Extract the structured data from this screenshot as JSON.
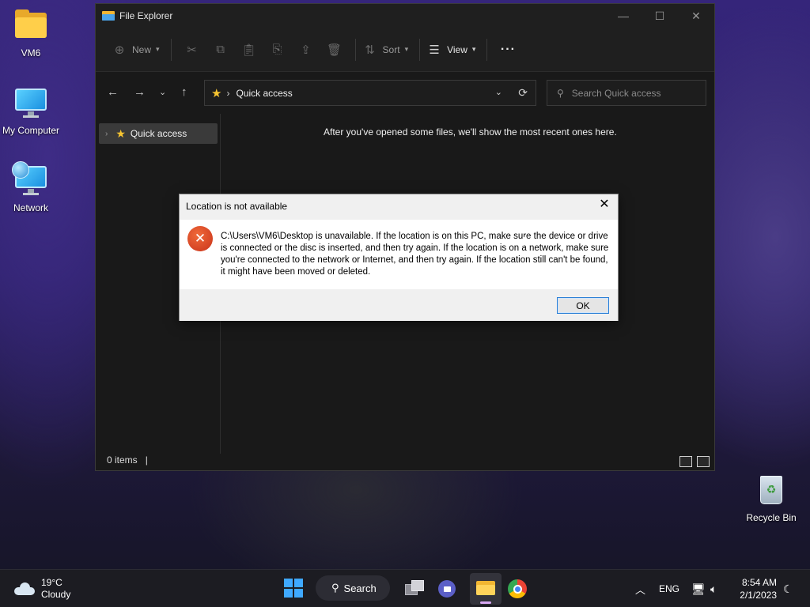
{
  "desktop": {
    "icons": [
      {
        "label": "VM6"
      },
      {
        "label": "My Computer"
      },
      {
        "label": "Network"
      },
      {
        "label": "Recycle Bin"
      }
    ]
  },
  "explorer": {
    "title": "File Explorer",
    "toolbar": {
      "new_label": "New",
      "sort_label": "Sort",
      "view_label": "View"
    },
    "address": {
      "path": "Quick access"
    },
    "search": {
      "placeholder": "Search Quick access"
    },
    "nav_pane": {
      "items": [
        {
          "label": "Quick access"
        }
      ]
    },
    "empty_message": "After you've opened some files, we'll show the most recent ones here.",
    "status": {
      "items_count": "0 items"
    }
  },
  "dialog": {
    "title": "Location is not available",
    "message": "C:\\Users\\VM6\\Desktop is unavailable. If the location is on this PC, make sure the device or drive is connected or the disc is inserted, and then try again. If the location is on a network, make sure you're connected to the network or Internet, and then try again. If the location still can't be found, it might have been moved or deleted.",
    "ok_label": "OK"
  },
  "taskbar": {
    "weather": {
      "temp": "19°C",
      "condition": "Cloudy"
    },
    "search_label": "Search",
    "language": "ENG",
    "time": "8:54 AM",
    "date": "2/1/2023"
  }
}
